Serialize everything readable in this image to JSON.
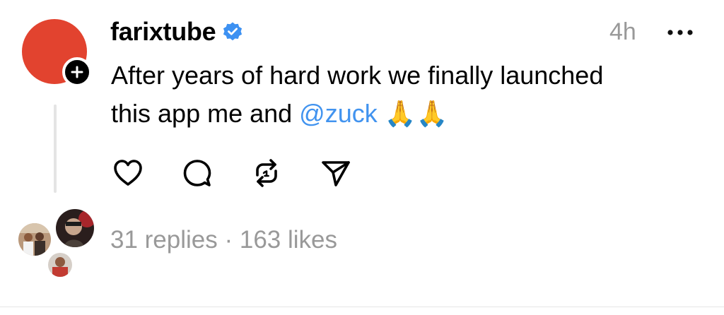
{
  "post": {
    "author": {
      "username": "farixtube",
      "verified": true,
      "avatar_color": "#e2432f",
      "badge_icon": "plus-icon"
    },
    "time": "4h",
    "more_icon": "more-horizontal-icon",
    "text_line1": "After years of hard work we finally launched",
    "text_line2_prefix": "this app me and ",
    "mention": "@zuck",
    "emoji": "🙏🙏",
    "actions": [
      {
        "icon": "heart-icon"
      },
      {
        "icon": "comment-icon"
      },
      {
        "icon": "repost-icon"
      },
      {
        "icon": "share-icon"
      }
    ],
    "stats": "31 replies · 163 likes"
  },
  "colors": {
    "mention": "#4193ef",
    "verified": "#3d91f2",
    "muted": "#999999"
  }
}
